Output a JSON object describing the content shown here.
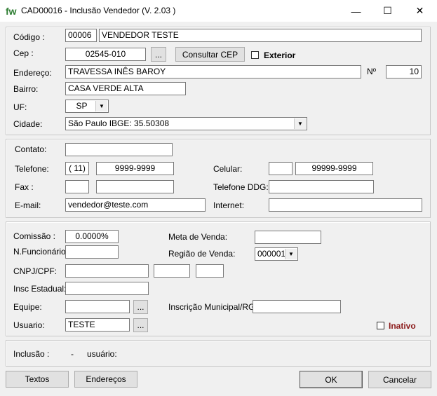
{
  "window": {
    "logo": "fw",
    "title": "CAD00016 - Inclusão  Vendedor  (V.  2.03 )",
    "minimize_icon": "—",
    "maximize_icon": "☐",
    "close_icon": "✕"
  },
  "section1": {
    "codigo_label": "Código :",
    "codigo_value": "00006",
    "nome_value": "VENDEDOR TESTE",
    "cep_label": "Cep :",
    "cep_value": "02545-010",
    "cep_lookup_label": "...",
    "consultar_cep_label": "Consultar CEP",
    "exterior_label": "Exterior",
    "endereco_label": "Endereço:",
    "endereco_value": "TRAVESSA INÊS BAROY",
    "numero_label": "Nº",
    "numero_value": "10",
    "bairro_label": "Bairro:",
    "bairro_value": "CASA VERDE ALTA",
    "uf_label": "UF:",
    "uf_value": "SP",
    "cidade_label": "Cidade:",
    "cidade_value": "São Paulo IBGE: 35.50308"
  },
  "section2": {
    "contato_label": "Contato:",
    "contato_value": "",
    "telefone_label": "Telefone:",
    "telefone_ddd": "( 11)",
    "telefone_value": "9999-9999",
    "celular_label": "Celular:",
    "celular_ddd": "",
    "celular_value": "99999-9999",
    "fax_label": "Fax :",
    "fax_ddd": "",
    "fax_value": "",
    "telefone_ddg_label": "Telefone DDG:",
    "telefone_ddg_value": "",
    "email_label": "E-mail:",
    "email_value": "vendedor@teste.com",
    "internet_label": "Internet:",
    "internet_value": ""
  },
  "section3": {
    "comissao_label": "Comissão :",
    "comissao_value": "0.0000%",
    "meta_label": "Meta de Venda:",
    "meta_value": "",
    "nfunc_label": "N.Funcionário:",
    "nfunc_value": "",
    "regiao_label": "Região de Venda:",
    "regiao_value": "000001",
    "cnpj_label": "CNPJ/CPF:",
    "insc_estadual_label": "Insc Estadual:",
    "equipe_label": "Equipe:",
    "equipe_lookup_label": "...",
    "insc_municipal_label": "Inscrição Municipal/RG:",
    "usuario_label": "Usuario:",
    "usuario_value": "TESTE",
    "usuario_lookup_label": "...",
    "inativo_label": "Inativo"
  },
  "status": {
    "inclusao_label": "Inclusão :",
    "inclusao_value": "-",
    "usuario_label": "usuário:"
  },
  "footer": {
    "textos_label": "Textos",
    "enderecos_label": "Endereços",
    "ok_label": "OK",
    "cancelar_label": "Cancelar"
  },
  "colors": {
    "inativo": "#8b1a1a",
    "logo": "#2e7d32"
  }
}
